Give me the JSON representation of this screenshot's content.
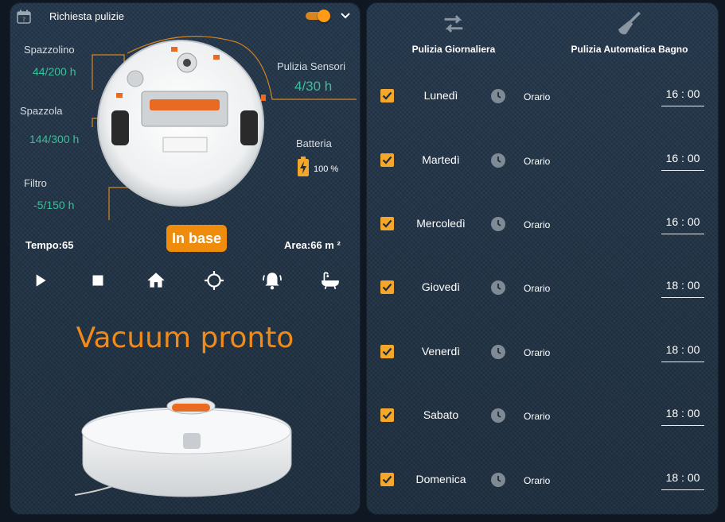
{
  "header": {
    "title": "Richiesta pulizie",
    "toggle_on": true
  },
  "sensors": {
    "spazzolino": {
      "label": "Spazzolino",
      "value": "44/200 h"
    },
    "spazzola": {
      "label": "Spazzola",
      "value": "144/300 h"
    },
    "filtro": {
      "label": "Filtro",
      "value": "-5/150 h"
    },
    "pulizia_sensori": {
      "label": "Pulizia Sensori",
      "value": "4/30 h"
    },
    "batteria": {
      "label": "Batteria",
      "value": "100 %"
    }
  },
  "stats": {
    "tempo": "Tempo:65",
    "area": "Area:66 m ²"
  },
  "state_badge": "In base",
  "status_text": "Vacuum pronto",
  "controls": [
    "play-icon",
    "stop-icon",
    "home-icon",
    "locate-icon",
    "bell-icon",
    "bathtub-icon"
  ],
  "modes": {
    "daily": "Pulizia Giornaliera",
    "bath": "Pulizia Automatica Bagno"
  },
  "schedule": {
    "orario_label": "Orario",
    "days": [
      {
        "name": "Lunedì",
        "time": "16 : 00",
        "checked": true
      },
      {
        "name": "Martedì",
        "time": "16 : 00",
        "checked": true
      },
      {
        "name": "Mercoledì",
        "time": "16 : 00",
        "checked": true
      },
      {
        "name": "Giovedì",
        "time": "18 : 00",
        "checked": true
      },
      {
        "name": "Venerdì",
        "time": "18 : 00",
        "checked": true
      },
      {
        "name": "Sabato",
        "time": "18 : 00",
        "checked": true
      },
      {
        "name": "Domenica",
        "time": "18 : 00",
        "checked": true
      }
    ]
  },
  "colors": {
    "accent": "#ef8c0c",
    "value_green": "#39c09a",
    "panel_bg": "#1f3041"
  }
}
